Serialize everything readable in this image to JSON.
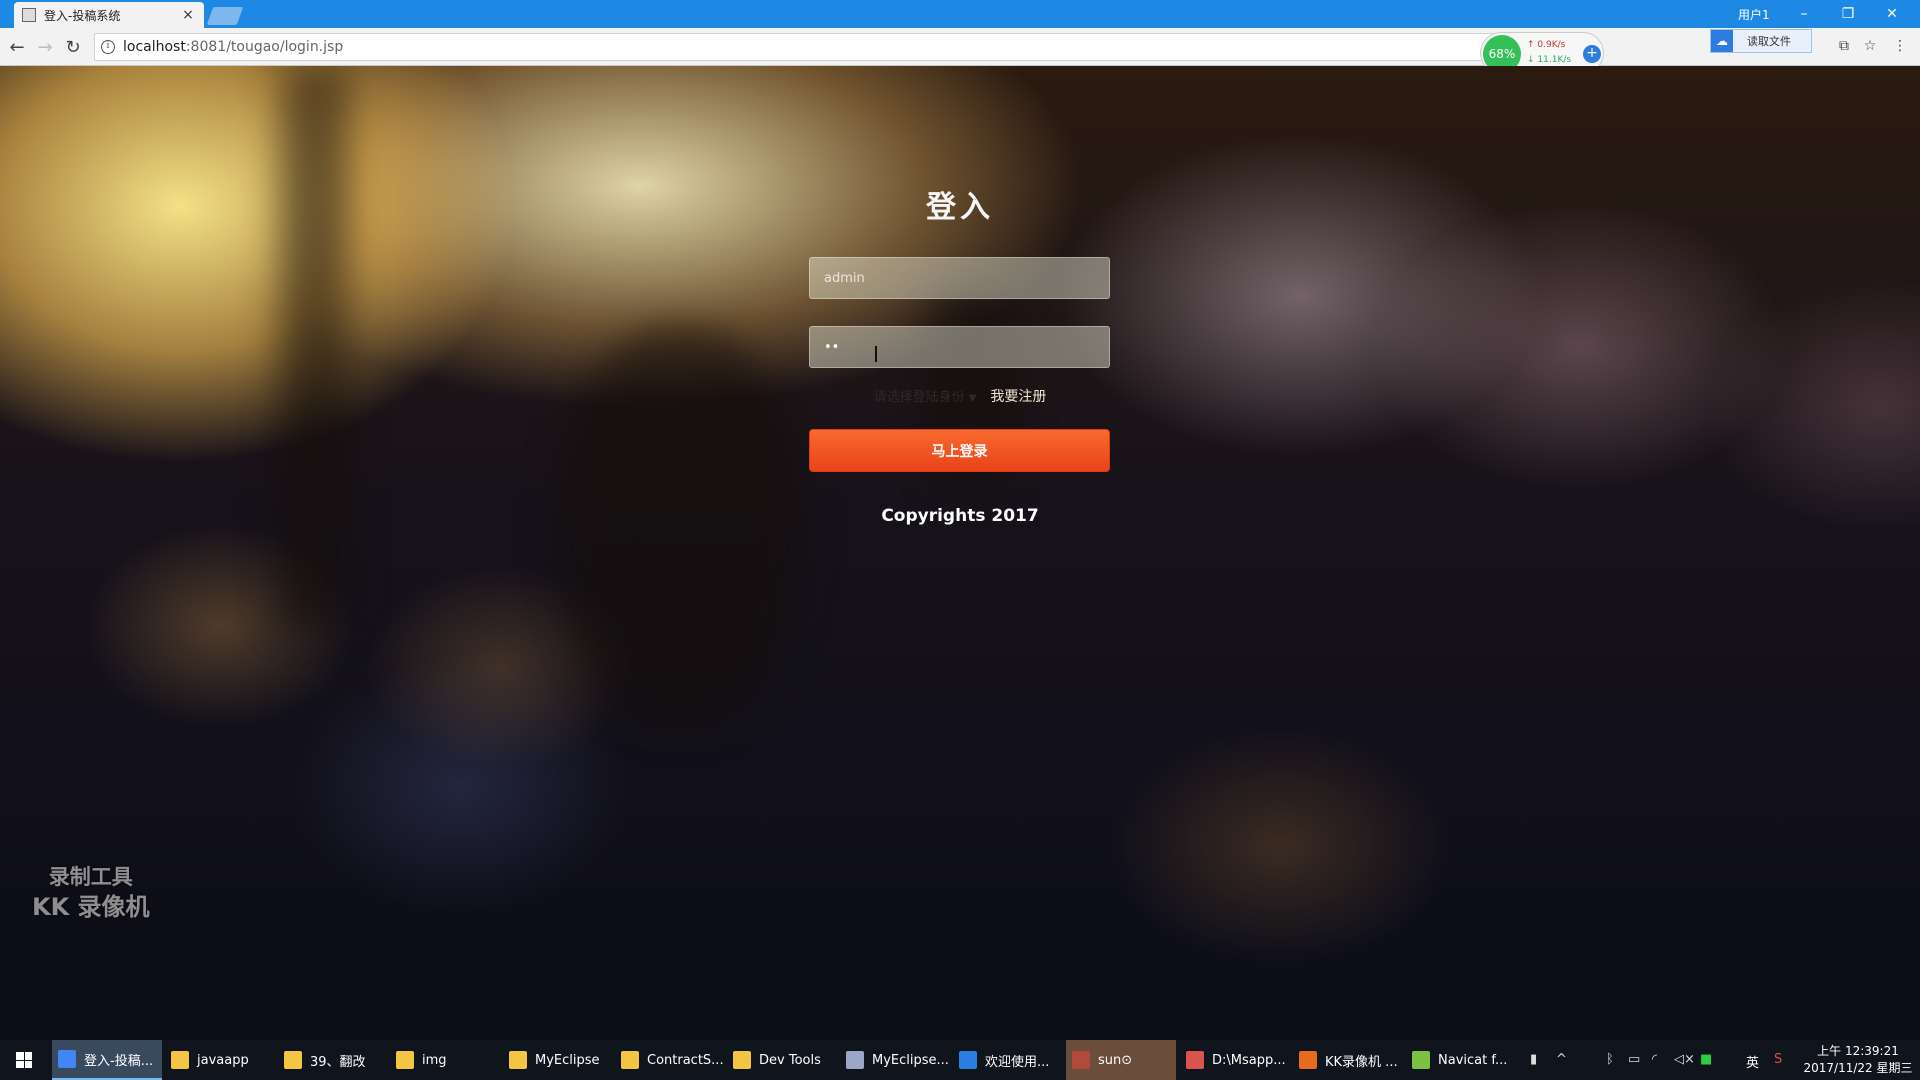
{
  "browser": {
    "tab_title": "登入-投稿系统",
    "tab_close": "×",
    "user_label": "用户1",
    "win_minimize": "–",
    "win_restore": "❐",
    "win_close": "✕",
    "url_host": "localhost",
    "url_rest": ":8081/tougao/login.jsp",
    "speed_percent": "68%",
    "upload_speed": "↑ 0.9K/s",
    "download_speed": "↓ 11.1K/s",
    "read_file_label": "读取文件"
  },
  "login": {
    "title": "登入",
    "username_placeholder": "admin",
    "password_value": "••",
    "identity_select": "请选择登陆身份",
    "register_link": "我要注册",
    "submit_label": "马上登录",
    "copyright": "Copyrights 2017"
  },
  "watermark": {
    "line1": "录制工具",
    "line2": "KK 录像机"
  },
  "taskbar": {
    "items": [
      {
        "label": "登入-投稿...",
        "color": "#4285f4"
      },
      {
        "label": "javaapp",
        "color": "#f4c542"
      },
      {
        "label": "39、翻改",
        "color": "#f4c542"
      },
      {
        "label": "img",
        "color": "#f4c542"
      },
      {
        "label": "MyEclipse",
        "color": "#f4c542"
      },
      {
        "label": "ContractS...",
        "color": "#f4c542"
      },
      {
        "label": "Dev Tools",
        "color": "#f4c542"
      },
      {
        "label": "MyEclipse...",
        "color": "#9aa7c9"
      },
      {
        "label": "欢迎使用...",
        "color": "#2d7de0"
      },
      {
        "label": "sun⊙",
        "color": "#b04a3a"
      },
      {
        "label": "D:\\Msapp...",
        "color": "#d9534f"
      },
      {
        "label": "KK录像机 ...",
        "color": "#e46b1f"
      },
      {
        "label": "Navicat f...",
        "color": "#7cc142"
      }
    ],
    "ime_label": "英",
    "time": "上午 12:39:21",
    "date": "2017/11/22 星期三"
  }
}
